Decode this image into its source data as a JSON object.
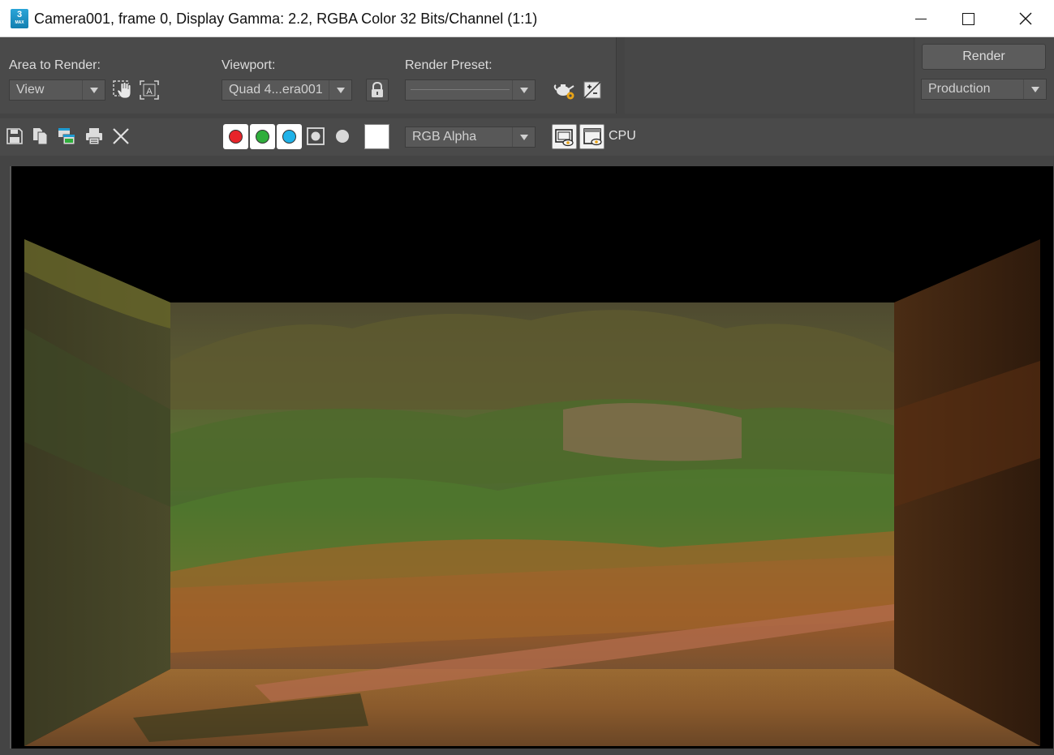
{
  "window": {
    "title": "Camera001, frame 0, Display Gamma: 2.2, RGBA Color 32 Bits/Channel (1:1)",
    "app_icon_text": "3",
    "app_icon_sub": "MAX"
  },
  "controls": {
    "area_to_render_label": "Area to Render:",
    "area_to_render_value": "View",
    "viewport_label": "Viewport:",
    "viewport_value": "Quad 4...era001",
    "render_preset_label": "Render Preset:",
    "render_preset_value": "",
    "render_button": "Render",
    "production_value": "Production"
  },
  "toolbar": {
    "channel_display_value": "RGB Alpha",
    "renderer_label": "CPU",
    "colors": {
      "red": "#e8242a",
      "green": "#2fae3c",
      "blue": "#1fb2e8",
      "swatch": "#ffffff"
    }
  },
  "icons": [
    "save-icon",
    "copy-icon",
    "clone-window-icon",
    "print-icon",
    "clear-icon",
    "lock-icon",
    "render-setup-icon",
    "environment-effects-icon",
    "edit-region-icon",
    "auto-region-icon",
    "display-toggle-icon",
    "frame-window-icon"
  ]
}
